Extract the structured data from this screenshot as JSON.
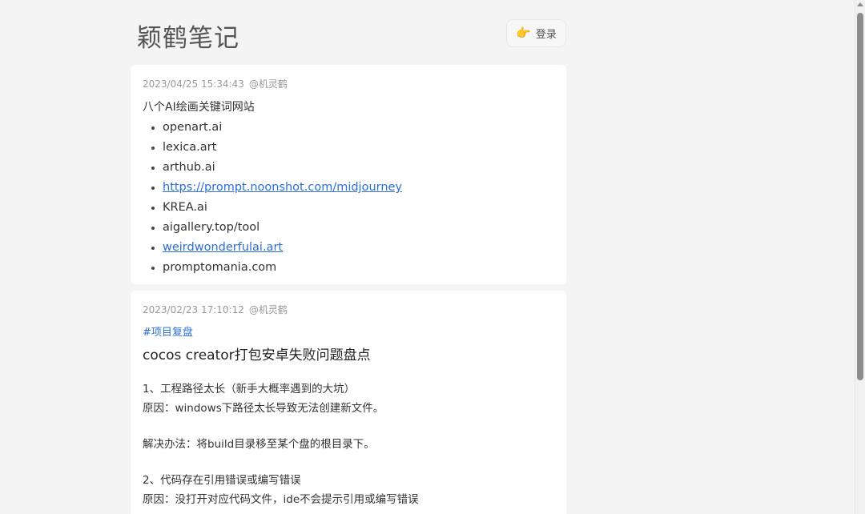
{
  "header": {
    "site_title": "颖鹤笔记",
    "login_icon": "pointing-hand-icon",
    "login_label": "登录"
  },
  "posts": [
    {
      "timestamp": "2023/04/25 15:34:43",
      "author": "@机灵鹤",
      "title": "八个AI绘画关键词网站",
      "links": [
        {
          "text": "openart.ai",
          "is_link": false
        },
        {
          "text": "lexica.art",
          "is_link": false
        },
        {
          "text": "arthub.ai",
          "is_link": false
        },
        {
          "text": "https://prompt.noonshot.com/midjourney",
          "is_link": true
        },
        {
          "text": "KREA.ai",
          "is_link": false
        },
        {
          "text": "aigallery.top/tool",
          "is_link": false
        },
        {
          "text": "weirdwonderfulai.art",
          "is_link": true
        },
        {
          "text": "promptomania.com",
          "is_link": false
        }
      ]
    },
    {
      "timestamp": "2023/02/23 17:10:12",
      "author": "@机灵鹤",
      "tag": "#项目复盘",
      "headline": "cocos creator打包安卓失败问题盘点",
      "paragraphs": [
        "1、工程路径太长（新手大概率遇到的大坑）",
        "原因：windows下路径太长导致无法创建新文件。",
        "解决办法：将build目录移至某个盘的根目录下。",
        "2、代码存在引用错误或编写错误",
        "原因：没打开对应代码文件，ide不会提示引用或编写错误"
      ]
    }
  ],
  "colors": {
    "link": "#2a6fdc",
    "background": "#f4f4f5",
    "card": "#ffffff"
  }
}
